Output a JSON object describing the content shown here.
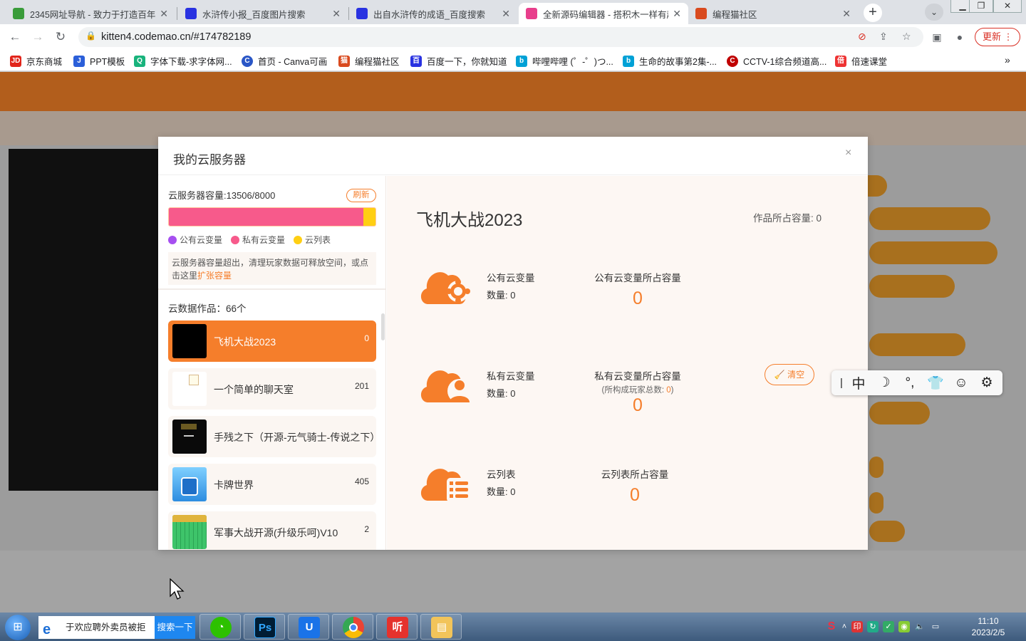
{
  "browser": {
    "tabs": [
      {
        "title": "2345网址导航 - 致力于打造百年",
        "icon_color": "#3a9c3a",
        "icon": "house-icon"
      },
      {
        "title": "水浒传小报_百度图片搜索",
        "icon_color": "#2932e1",
        "icon": "baidu-paw-icon"
      },
      {
        "title": "出自水浒传的成语_百度搜索",
        "icon_color": "#2932e1",
        "icon": "baidu-paw-icon"
      },
      {
        "title": "全新源码编辑器 - 搭积木一样有趣",
        "icon_color": "#e83e8c",
        "icon": "codemao-icon"
      },
      {
        "title": "编程猫社区",
        "icon_color": "#d94a1e",
        "icon": "codemao-cat-icon"
      }
    ],
    "url": "kitten4.codemao.cn/#174782189",
    "update_label": "更新",
    "bookmarks": [
      {
        "label": "京东商城",
        "color": "#e1251b",
        "mark": "JD"
      },
      {
        "label": "PPT模板",
        "color": "#2b5fd9",
        "mark": "J"
      },
      {
        "label": "字体下载-求字体网...",
        "color": "#19b37c",
        "mark": "Q"
      },
      {
        "label": "首页 - Canva可画",
        "color": "#2a56c6",
        "mark": "C"
      },
      {
        "label": "编程猫社区",
        "color": "#d94a1e",
        "mark": "猫"
      },
      {
        "label": "百度一下，你就知道",
        "color": "#2932e1",
        "mark": "百"
      },
      {
        "label": "哔哩哔哩 (゜-゜)つ...",
        "color": "#00a1d6",
        "mark": "b"
      },
      {
        "label": "生命的故事第2集-...",
        "color": "#00a1d6",
        "mark": "b"
      },
      {
        "label": "CCTV-1综合频道高...",
        "color": "#c00000",
        "mark": "C"
      },
      {
        "label": "倍速课堂",
        "color": "#e33",
        "mark": "倍"
      }
    ]
  },
  "modal": {
    "title": "我的云服务器",
    "capacity_label": "云服务器容量:13506/8000",
    "refresh_label": "刷新",
    "capacity_bar": {
      "private_fraction": 0.94,
      "list_fraction": 0.06
    },
    "legend": [
      {
        "label": "公有云变量",
        "color": "#a64ff0"
      },
      {
        "label": "私有云变量",
        "color": "#f75a8b"
      },
      {
        "label": "云列表",
        "color": "#ffcf13"
      }
    ],
    "notice_text": "云服务器容量超出，清理玩家数据可释放空间，或点击这里",
    "notice_link": "扩张容量",
    "works_count_label": "云数据作品：66个",
    "works": [
      {
        "name": "飞机大战2023",
        "count": "0"
      },
      {
        "name": "一个简单的聊天室",
        "count": "201"
      },
      {
        "name": "手残之下（开源-元气骑士-传说之下）",
        "count": ""
      },
      {
        "name": "卡牌世界",
        "count": "405"
      },
      {
        "name": "军事大战开源(升级乐呵)V10",
        "count": "2"
      }
    ],
    "detail": {
      "project_name": "飞机大战2023",
      "project_capacity": "作品所占容量: 0",
      "public": {
        "name": "公有云变量",
        "count_label": "数量: 0",
        "cap_label": "公有云变量所占容量",
        "cap_value": "0"
      },
      "private": {
        "name": "私有云变量",
        "count_label": "数量: 0",
        "cap_label": "私有云变量所占容量",
        "sub_prefix": "(所构成玩家总数: ",
        "sub_value": "0",
        "sub_suffix": ")",
        "cap_value": "0",
        "clear_label": "清空"
      },
      "list": {
        "name": "云列表",
        "count_label": "数量: 0",
        "cap_label": "云列表所占容量",
        "cap_value": "0"
      }
    },
    "close_glyph": "×"
  },
  "ime": {
    "items": [
      "中",
      "☽",
      "°,",
      "👕",
      "☺",
      "⚙"
    ]
  },
  "taskbar": {
    "search_text": "于欢应聘外卖员被拒",
    "search_button": "搜索一下",
    "time": "11:10",
    "date": "2023/2/5"
  }
}
